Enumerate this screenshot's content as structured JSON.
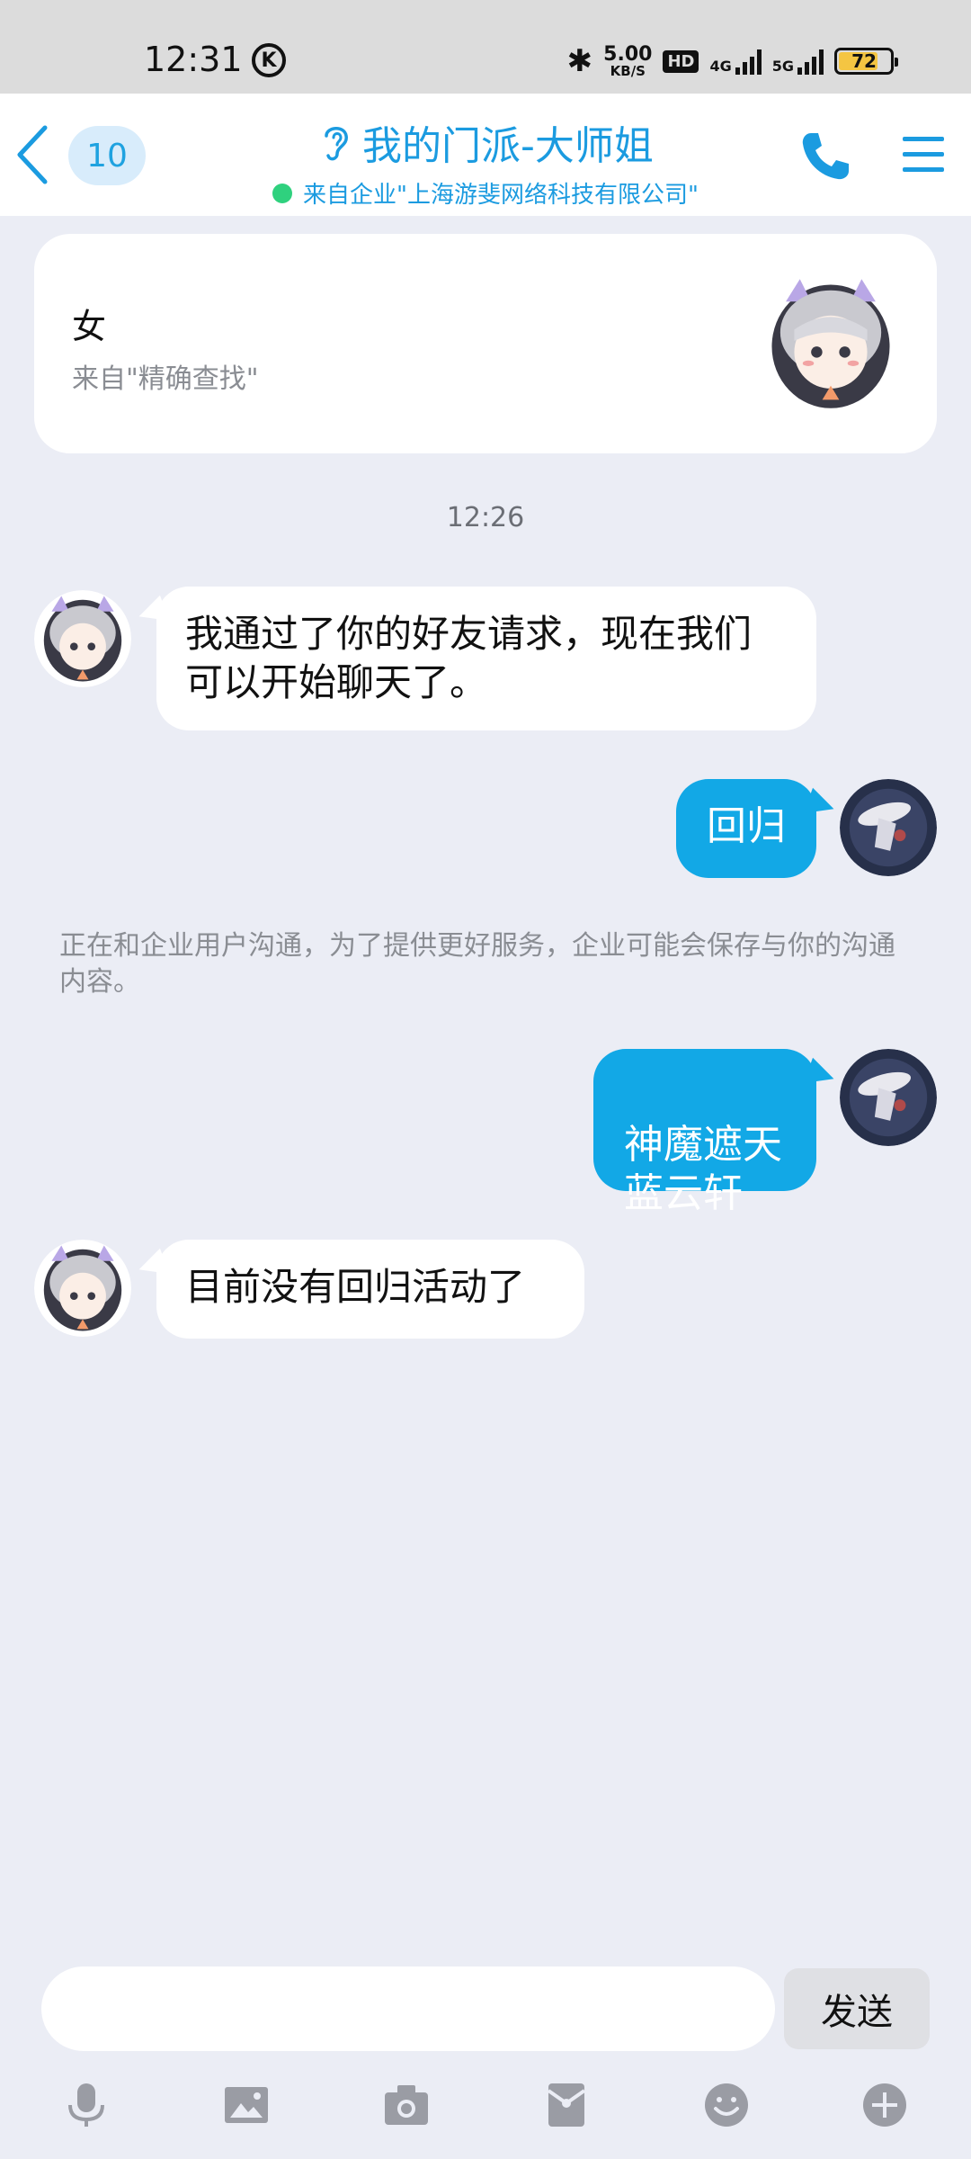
{
  "status_bar": {
    "time": "12:31",
    "k_icon": "K",
    "speed_value": "5.00",
    "speed_unit": "KB/S",
    "hd": "HD",
    "net1": "4G",
    "net2": "5G",
    "battery": "72"
  },
  "header": {
    "unread_count": "10",
    "title": "我的门派-大师姐",
    "subtitle": "来自企业\"上海游斐网络科技有限公司\""
  },
  "profile_card": {
    "gender": "女",
    "source": "来自\"精确查找\""
  },
  "timestamp": "12:26",
  "messages": [
    {
      "side": "left",
      "text": "我通过了你的好友请求，现在我们可以开始聊天了。"
    },
    {
      "side": "right",
      "text": "回归"
    },
    {
      "side": "right",
      "text": "神魔遮天\n蓝云轩"
    },
    {
      "side": "left",
      "text": "目前没有回归活动了"
    }
  ],
  "notice": "正在和企业用户沟通，为了提供更好服务，企业可能会保存与你的沟通内容。",
  "composer": {
    "input_value": "",
    "send_label": "发送"
  },
  "toolbar_icons": [
    "microphone-icon",
    "image-icon",
    "camera-icon",
    "red-packet-icon",
    "emoji-icon",
    "plus-icon"
  ],
  "colors": {
    "accent": "#1b9be0",
    "bubble_sent": "#12a8e6",
    "background": "#ebedf5"
  }
}
